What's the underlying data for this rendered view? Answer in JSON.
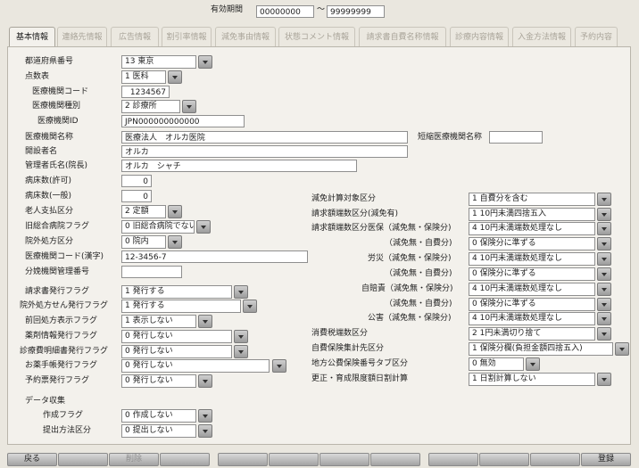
{
  "header": {
    "validity_label": "有効期間",
    "date_from": "00000000",
    "date_sep": "〜",
    "date_to": "99999999"
  },
  "tabs": [
    "基本情報",
    "連絡先情報",
    "広告情報",
    "割引率情報",
    "減免事由情報",
    "状態コメント情報",
    "請求書自費名称情報",
    "診療内容情報",
    "入金方法情報",
    "予約内容"
  ],
  "left": {
    "pref_label": "都道府県番号",
    "pref_value": "13 東京",
    "score_label": "点数表",
    "score_value": "1 医科",
    "inst_code_label": "医療機関コード",
    "inst_code_value": "1234567",
    "inst_type_label": "医療機関種別",
    "inst_type_value": "2 診療所",
    "inst_id_label": "医療機関ID",
    "inst_id_value": "JPN000000000000",
    "inst_name_label": "医療機関名称",
    "inst_name_value": "医療法人　オルカ医院",
    "short_name_label": "短縮医療機関名称",
    "short_name_value": "",
    "founder_label": "開設者名",
    "founder_value": "オルカ",
    "manager_label": "管理者氏名(院長)",
    "manager_value": "オルカ　シャチ",
    "beds_permit_label": "病床数(許可)",
    "beds_permit_value": "0",
    "beds_general_label": "病床数(一般)",
    "beds_general_value": "0",
    "elderly_label": "老人支払区分",
    "elderly_value": "2 定額",
    "old_general_label": "旧総合病院フラグ",
    "old_general_value": "0 旧総合病院でない",
    "outpatient_label": "院外処方区分",
    "outpatient_value": "0 院内",
    "kanji_code_label": "医療機関コード(漢字)",
    "kanji_code_value": "12-3456-7",
    "branch_label": "分娩機関管理番号",
    "branch_value": "",
    "invoice_label": "請求書発行フラグ",
    "invoice_value": "1 発行する",
    "rx_label": "院外処方せん発行フラグ",
    "rx_value": "1 発行する",
    "prev_rx_label": "前回処方表示フラグ",
    "prev_rx_value": "1 表示しない",
    "drug_info_label": "薬剤情報発行フラグ",
    "drug_info_value": "0 発行しない",
    "detail_label": "診療費明細書発行フラグ",
    "detail_value": "0 発行しない",
    "notebook_label": "お薬手帳発行フラグ",
    "notebook_value": "0 発行しない",
    "appt_label": "予約票発行フラグ",
    "appt_value": "0 発行しない",
    "data_section": "データ収集",
    "create_label": "作成フラグ",
    "create_value": "0 作成しない",
    "submit_label": "提出方法区分",
    "submit_value": "0 提出しない"
  },
  "right": {
    "rows": [
      {
        "label": "減免計算対象区分",
        "value": "1 自費分を含む"
      },
      {
        "label": "請求額端数区分(減免有)",
        "value": "1 10円未満四捨五入"
      },
      {
        "label": "請求額端数区分医保（減免無・保険分)",
        "value": "4 10円未満端数処理なし"
      },
      {
        "label": "（減免無・自費分)",
        "value": "0 保険分に準ずる"
      },
      {
        "label": "労災（減免無・保険分)",
        "value": "4 10円未満端数処理なし"
      },
      {
        "label": "（減免無・自費分)",
        "value": "0 保険分に準ずる"
      },
      {
        "label": "自賠責（減免無・保険分)",
        "value": "4 10円未満端数処理なし"
      },
      {
        "label": "（減免無・自費分)",
        "value": "0 保険分に準ずる"
      },
      {
        "label": "公害（減免無・保険分)",
        "value": "4 10円未満端数処理なし"
      },
      {
        "label": "消費税端数区分",
        "value": "2 1円未満切り捨て"
      },
      {
        "label": "自費保険集計先区分",
        "value": "1 保険分欄(負担金額四捨五入)"
      },
      {
        "label": "地方公費保険番号タブ区分",
        "value": "0 無効"
      },
      {
        "label": "更正・育成限度額日割計算",
        "value": "1 日割計算しない"
      }
    ]
  },
  "footer": {
    "back": "戻る",
    "delete": "削除",
    "register": "登録"
  }
}
